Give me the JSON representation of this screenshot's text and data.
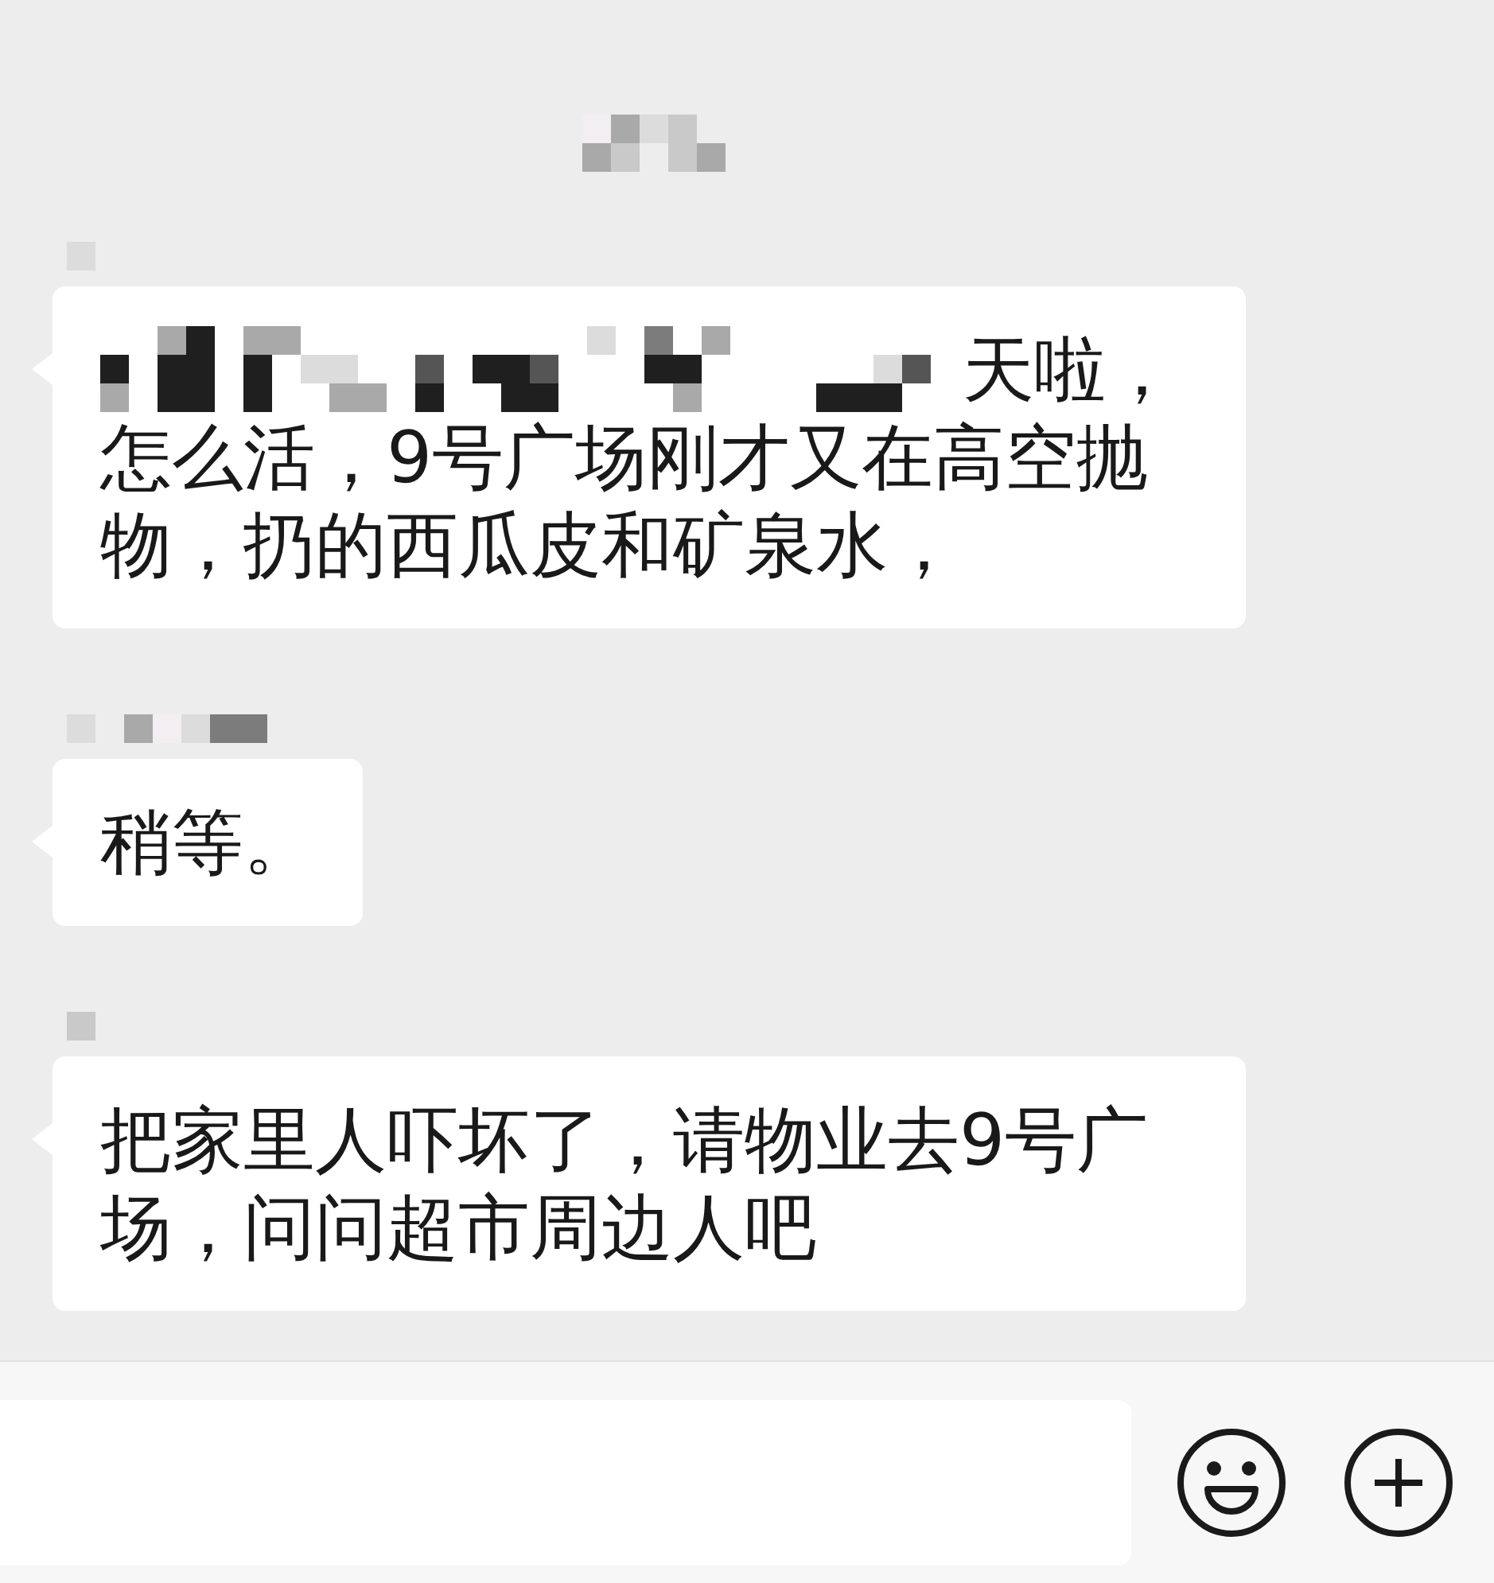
{
  "top_label": {
    "redacted": true
  },
  "messages": [
    {
      "sender_redacted": true,
      "redacted_prefix": true,
      "text": "天啦，怎么活，9号广场刚才又在高空抛物，扔的西瓜皮和矿泉水，"
    },
    {
      "sender_redacted": true,
      "redacted_prefix": false,
      "text": "稍等。"
    },
    {
      "sender_redacted": true,
      "redacted_prefix": false,
      "text": "把家里人吓坏了，请物业去9号广场，问问超市周边人吧"
    }
  ]
}
